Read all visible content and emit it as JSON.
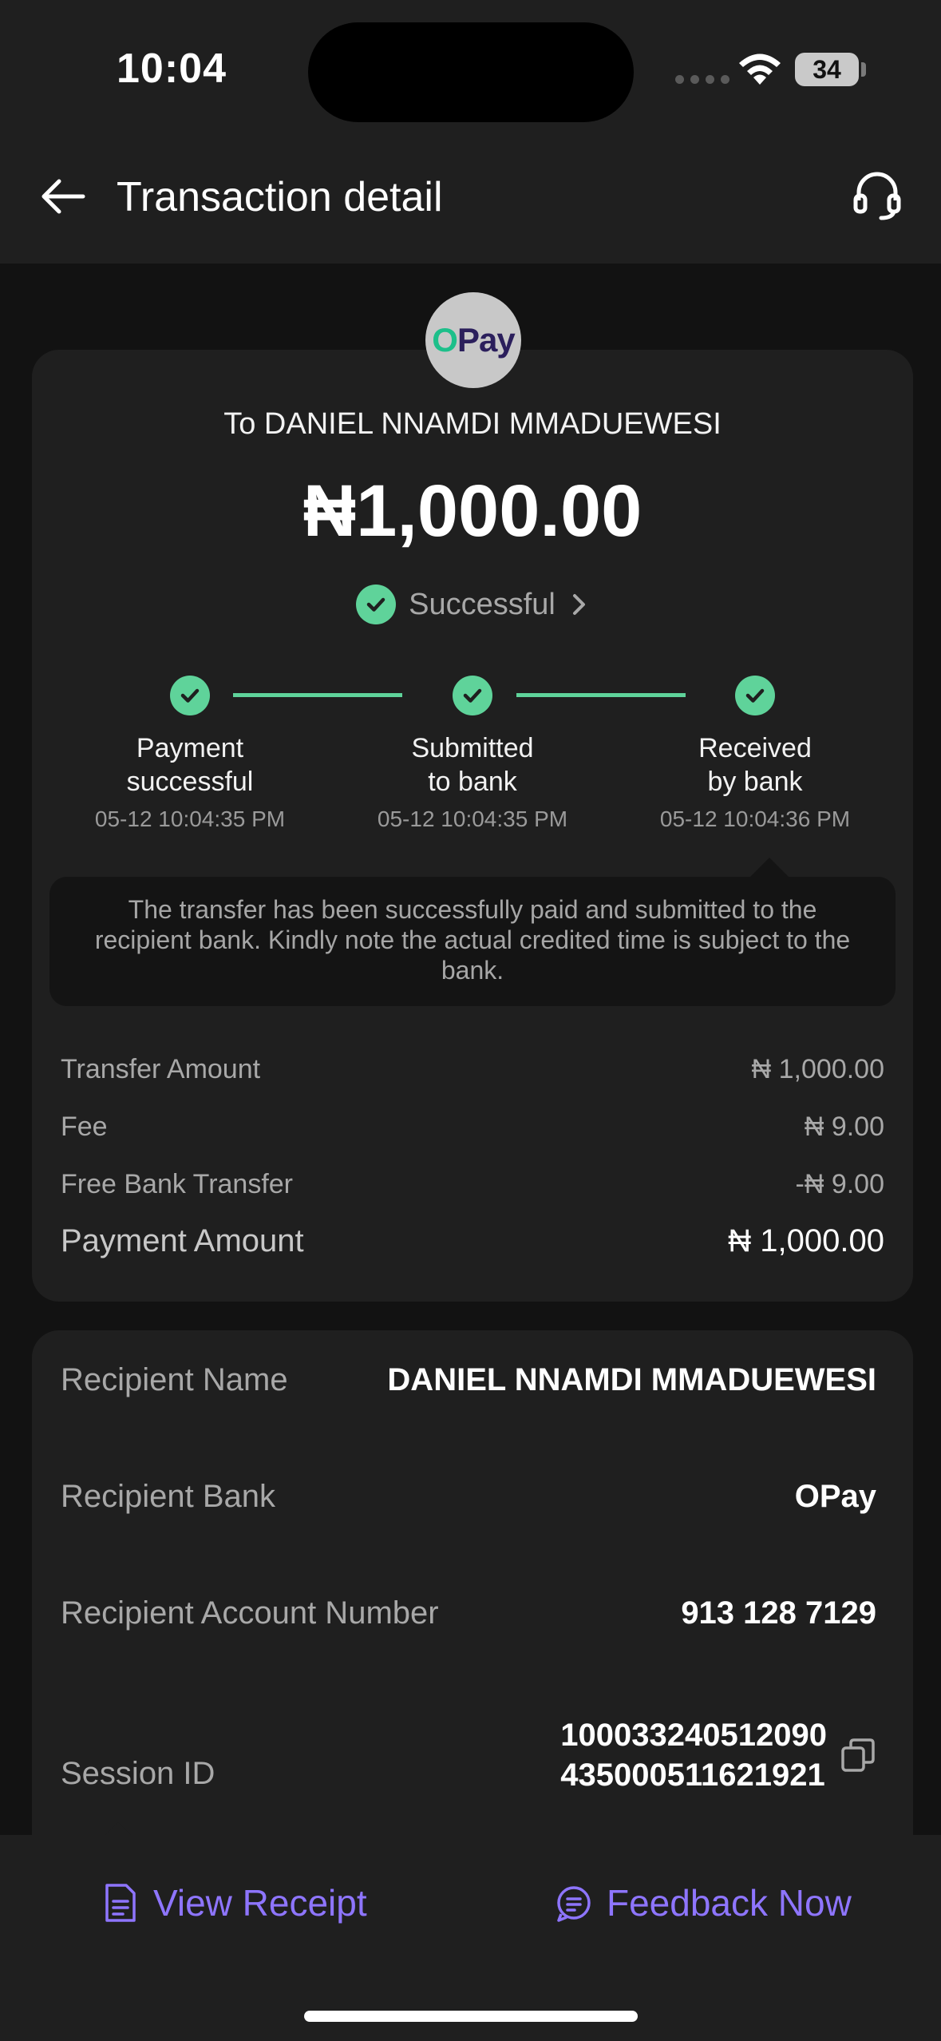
{
  "status_bar": {
    "time": "10:04",
    "battery": "34"
  },
  "header": {
    "title": "Transaction detail"
  },
  "logo": {
    "text_o": "O",
    "text_rest": "Pay"
  },
  "summary": {
    "to_name": "To DANIEL NNAMDI MMADUEWESI",
    "amount": "₦1,000.00",
    "status": "Successful"
  },
  "steps": [
    {
      "label_line1": "Payment",
      "label_line2": "successful",
      "time": "05-12 10:04:35 PM"
    },
    {
      "label_line1": "Submitted",
      "label_line2": "to bank",
      "time": "05-12 10:04:35 PM"
    },
    {
      "label_line1": "Received",
      "label_line2": "by bank",
      "time": "05-12 10:04:36 PM"
    }
  ],
  "note": "The transfer has been successfully paid and submitted to the recipient bank. Kindly note the actual credited time is subject to the bank.",
  "fees": [
    {
      "label": "Transfer Amount",
      "value": "₦ 1,000.00"
    },
    {
      "label": "Fee",
      "value": "₦ 9.00"
    },
    {
      "label": "Free Bank Transfer",
      "value": "-₦ 9.00"
    },
    {
      "label": "Payment Amount",
      "value": "₦ 1,000.00"
    }
  ],
  "details": [
    {
      "label": "Recipient Name",
      "value": "DANIEL NNAMDI MMADUEWESI"
    },
    {
      "label": "Recipient Bank",
      "value": "OPay"
    },
    {
      "label": "Recipient Account Number",
      "value": "913 128 7129"
    },
    {
      "label": "Session ID",
      "value_line1": "100033240512090",
      "value_line2": "435000511621921"
    }
  ],
  "actions": {
    "view_receipt": "View Receipt",
    "feedback": "Feedback Now"
  },
  "colors": {
    "accent": "#8e75ff",
    "success": "#5fd39a",
    "background": "#121212",
    "card": "#1f1f1f"
  }
}
